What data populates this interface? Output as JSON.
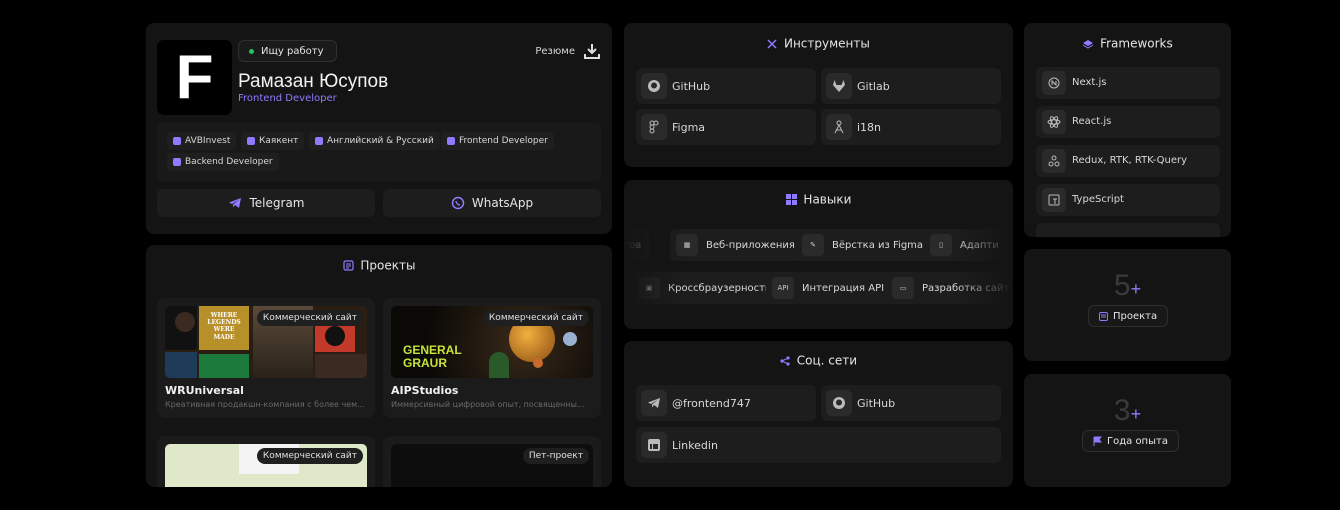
{
  "profile": {
    "logo_letter": "F",
    "status": "Ищу работу",
    "resume": "Резюме",
    "name": "Рамазан Юсупов",
    "role": "Frontend Developer",
    "chips": [
      "AVBInvest",
      "Каякент",
      "Английский & Русский",
      "Frontend Developer",
      "Backend Developer"
    ],
    "telegram": "Telegram",
    "whatsapp": "WhatsApp",
    "status_color": "#22c55e",
    "accent": "#8f7bff"
  },
  "projects": {
    "title": "Проекты",
    "items": [
      {
        "name": "WRUniversal",
        "desc": "Креативная продакшн-компания с более чем...",
        "tag": "Коммерческий сайт",
        "img_text": "WHERE LEGENDS WERE MADE"
      },
      {
        "name": "AIPStudios",
        "desc": "Иммерсивный цифровой опыт, посвященны...",
        "tag": "Коммерческий сайт",
        "img_text": "GENERAL GRAUR"
      },
      {
        "name": "",
        "desc": "",
        "tag": "Коммерческий сайт"
      },
      {
        "name": "",
        "desc": "",
        "tag": "Пет-проект"
      }
    ]
  },
  "tools": {
    "title": "Инструменты",
    "items": [
      {
        "label": "GitHub",
        "icon": "github-icon"
      },
      {
        "label": "Gitlab",
        "icon": "gitlab-icon"
      },
      {
        "label": "Figma",
        "icon": "figma-icon"
      },
      {
        "label": "i18n",
        "icon": "i18n-icon"
      }
    ]
  },
  "skills": {
    "title": "Навыки",
    "row1": [
      "гов",
      "Веб-приложения",
      "Вёрстка из Figma",
      "Адапти"
    ],
    "row2": [
      "Кроссбраузерность",
      "Интеграция API",
      "Разработка сайт"
    ],
    "api_icon_text": "API"
  },
  "social": {
    "title": "Соц. сети",
    "items": [
      {
        "label": "@frontend747",
        "icon": "telegram-icon"
      },
      {
        "label": "GitHub",
        "icon": "github-icon"
      },
      {
        "label": "Linkedin",
        "icon": "linkedin-icon"
      }
    ]
  },
  "frameworks": {
    "title": "Frameworks",
    "items": [
      {
        "label": "Next.js",
        "icon": "nextjs-icon"
      },
      {
        "label": "React.js",
        "icon": "react-icon"
      },
      {
        "label": "Redux, RTK, RTK-Query",
        "icon": "redux-icon"
      },
      {
        "label": "TypeScript",
        "icon": "typescript-icon"
      }
    ]
  },
  "stats": [
    {
      "number": "5",
      "plus": "+",
      "label": "Проекта"
    },
    {
      "number": "3",
      "plus": "+",
      "label": "Года опыта"
    }
  ]
}
